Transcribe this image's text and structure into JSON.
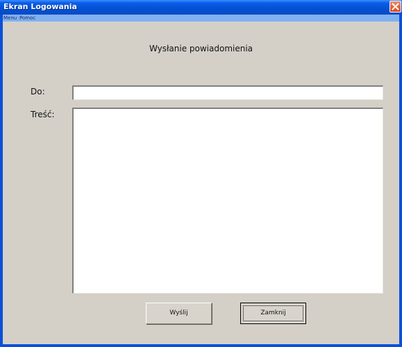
{
  "window": {
    "title": "Ekran Logowania"
  },
  "menubar": {
    "items": [
      "Menu",
      "Pomoc"
    ]
  },
  "form": {
    "heading": "Wysłanie powiadomienia",
    "to_label": "Do:",
    "to_value": "",
    "body_label": "Treść:",
    "body_value": ""
  },
  "buttons": {
    "send": "Wyślij",
    "close": "Zamknij"
  },
  "colors": {
    "titlebar": "#0a50d8",
    "menubar": "#7fb0f2",
    "window_bg": "#d4d0c8",
    "close_button": "#d6491f"
  },
  "icons": {
    "close": "close-x-icon"
  }
}
